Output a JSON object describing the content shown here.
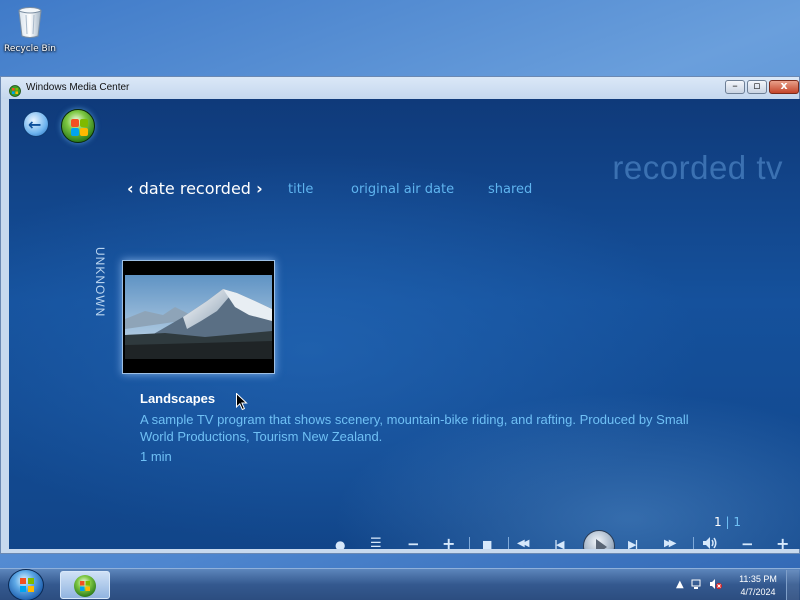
{
  "desktop": {
    "icons": [
      {
        "label": "Recycle Bin",
        "icon": "recycle-bin-icon"
      }
    ]
  },
  "window": {
    "title": "Windows Media Center",
    "controls": {
      "minimize": "–",
      "maximize": "▫",
      "close": "x"
    }
  },
  "media_center": {
    "page_title": "recorded tv",
    "nav": {
      "active_tab": "date recorded",
      "prev_chevron": "‹",
      "next_chevron": "›",
      "tabs": [
        "title",
        "original air date",
        "shared"
      ]
    },
    "group_label": "UNKNOWN",
    "item": {
      "title": "Landscapes",
      "description": "A sample TV program that shows scenery, mountain-bike riding, and rafting. Produced by Small World Productions, Tourism New Zealand.",
      "duration": "1 min",
      "thumbnail": "mountain-landscape"
    },
    "pager": {
      "current": "1",
      "separator": "|",
      "total": "1"
    },
    "transport": {
      "record": "●",
      "guide": "☰",
      "channel_down": "−",
      "channel_up": "+",
      "stop": "■",
      "rewind": "◀◀",
      "skip_back": "|◀",
      "play": "play",
      "skip_forward": "▶|",
      "fast_forward": "▶▶",
      "mute": "🔊",
      "volume_down": "−",
      "volume_up": "+"
    }
  },
  "taskbar": {
    "running_app": "Windows Media Center",
    "tray": {
      "time": "11:35 PM",
      "date": "4/7/2024",
      "show_hidden": "▲"
    }
  },
  "colors": {
    "mc_accent": "#6fc0f5",
    "mc_background": "#15519c",
    "taskbar": "#34598f"
  }
}
